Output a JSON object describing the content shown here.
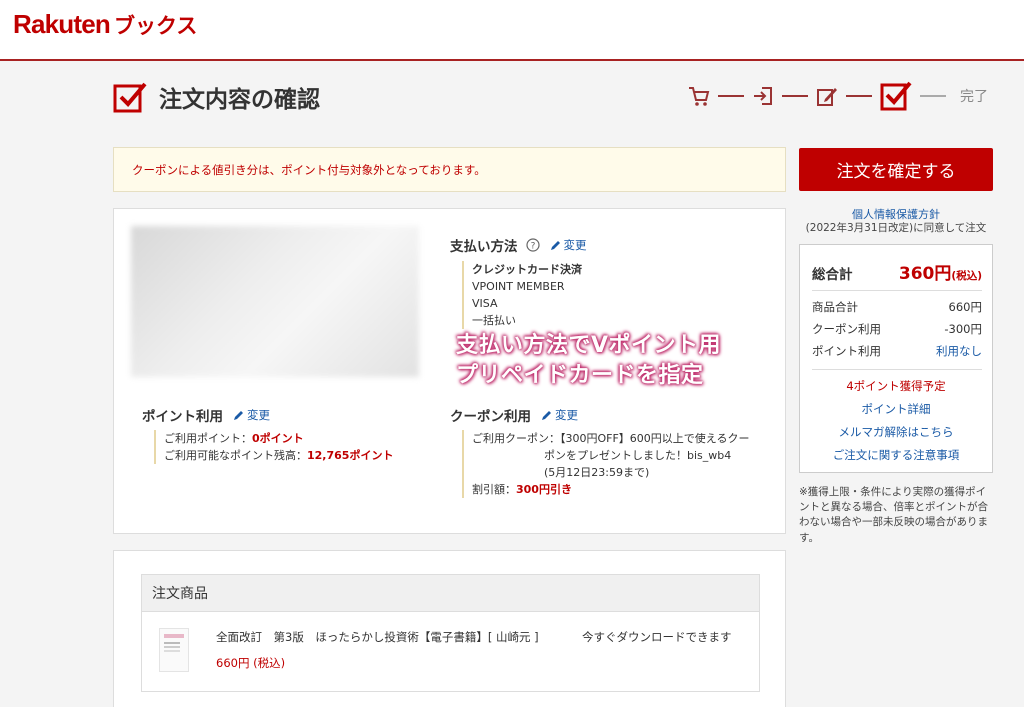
{
  "header": {
    "logo_main": "Rakuten",
    "logo_sub": "ブックス"
  },
  "page": {
    "title": "注文内容の確認"
  },
  "steps": {
    "done_label": "完了"
  },
  "notice": {
    "text": "クーポンによる値引き分は、ポイント付与対象外となっております。"
  },
  "payment": {
    "title": "支払い方法",
    "edit_label": "変更",
    "method": "クレジットカード決済",
    "card_name": "VPOINT MEMBER",
    "brand": "VISA",
    "installment": "一括払い"
  },
  "points": {
    "title": "ポイント利用",
    "edit_label": "変更",
    "used_label": "ご利用ポイント：",
    "used_value": "0ポイント",
    "balance_label": "ご利用可能なポイント残高：",
    "balance_value": "12,765ポイント"
  },
  "coupon": {
    "title": "クーポン利用",
    "edit_label": "変更",
    "line1": "ご利用クーポン：【300円OFF】600円以上で使えるクー",
    "line2": "ポンをプレゼントしました！bis_wb4",
    "line3": "(5月12日23:59まで)",
    "discount_label": "割引額：",
    "discount_value": "300円引き"
  },
  "overlay": {
    "line1": "支払い方法でVポイント用",
    "line2": "プリペイドカードを指定"
  },
  "sidebar": {
    "confirm_button": "注文を確定する",
    "privacy_link": "個人情報保護方針",
    "privacy_note": "(2022年3月31日改定)に同意して注文",
    "total_label": "総合計",
    "total_amount": "360円",
    "total_tax": "(税込)",
    "rows": [
      {
        "label": "商品合計",
        "value": "660円"
      },
      {
        "label": "クーポン利用",
        "value": "-300円"
      },
      {
        "label": "ポイント利用",
        "value": "利用なし"
      }
    ],
    "points_earn": "4ポイント獲得予定",
    "links": [
      "ポイント詳細",
      "メルマガ解除はこちら",
      "ご注文に関する注意事項"
    ],
    "footnote": "※獲得上限・条件により実際の獲得ポイントと異なる場合、倍率とポイントが合わない場合や一部未反映の場合があります。"
  },
  "products": {
    "header": "注文商品",
    "items": [
      {
        "name": "全面改訂　第3版　ほったらかし投資術【電子書籍】[ 山崎元 ]",
        "price": "660円 (税込)",
        "status": "今すぐダウンロードできます"
      }
    ]
  },
  "colors": {
    "brand": "#bf0000",
    "link": "#1a5aa6",
    "notice_bg": "#fffbea"
  }
}
